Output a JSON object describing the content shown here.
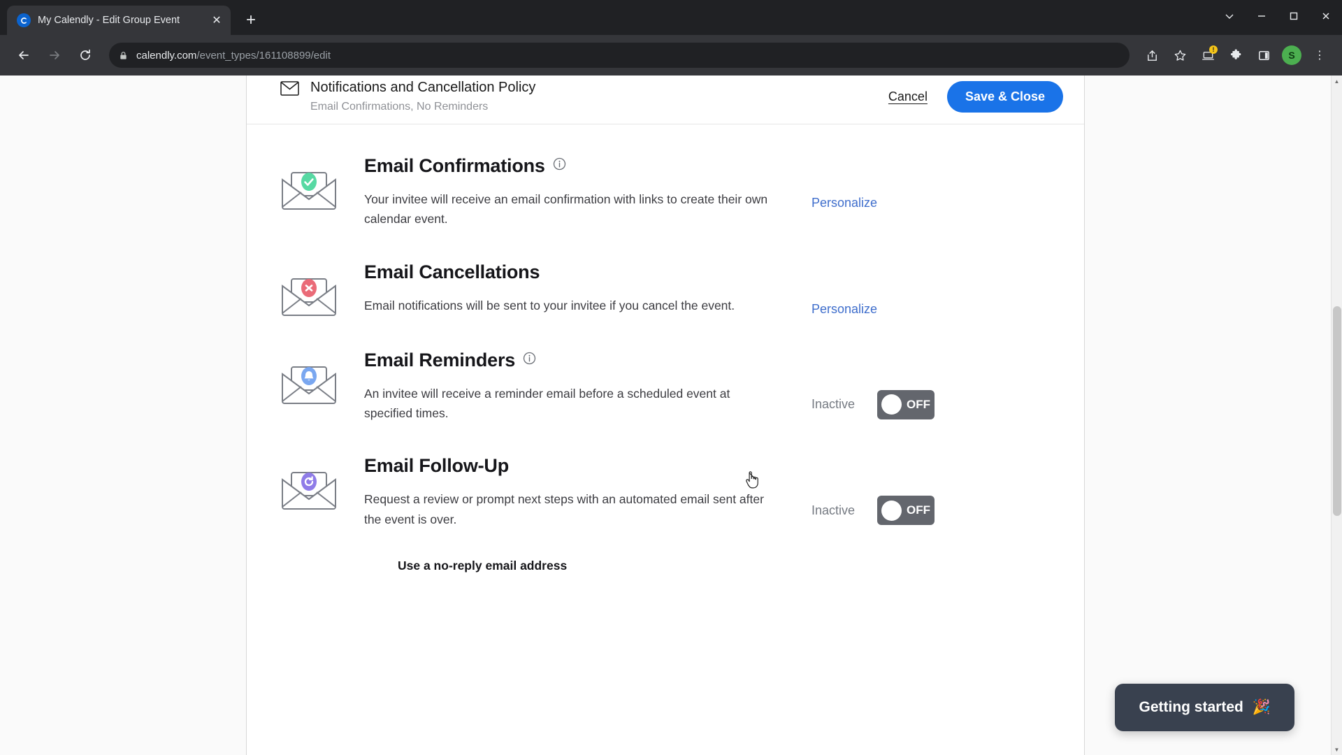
{
  "browser": {
    "tab": {
      "title": "My Calendly - Edit Group Event",
      "favicon_name": "calendly-favicon",
      "close_label": "✕"
    },
    "new_tab_label": "+",
    "window_controls": [
      "minimize-to-tray",
      "minimize",
      "maximize",
      "close"
    ],
    "nav": {
      "back_label": "←",
      "forward_label": "→",
      "reload_label": "↻"
    },
    "omnibox": {
      "domain": "calendly.com",
      "path": "/event_types/161108899/edit",
      "lock_icon": "lock-icon"
    },
    "toolbar_icons": [
      "share-icon",
      "bookmark-star-icon",
      "update-laptop-icon",
      "extensions-puzzle-icon",
      "side-panel-icon"
    ],
    "update_badge": "!",
    "profile_initial": "S",
    "menu_label": "⋮"
  },
  "header": {
    "icon": "mail-outline-icon",
    "title": "Notifications and Cancellation Policy",
    "subtitle": "Email Confirmations, No Reminders",
    "cancel_label": "Cancel",
    "save_label": "Save & Close"
  },
  "accent_colors": {
    "primary_button": "#1a73e8",
    "link": "#3f6ecc",
    "confirm_badge": "#57d9a3",
    "cancel_badge": "#ea6b78",
    "reminder_badge": "#7aa7f0",
    "followup_badge": "#8f7ce8",
    "toggle_off": "#63666d",
    "getting_started_bg": "#39414f"
  },
  "sections": [
    {
      "id": "email-confirmations",
      "badge_icon": "check-circle-icon",
      "badge_color": "#57d9a3",
      "title": "Email Confirmations",
      "has_info": true,
      "description": "Your invitee will receive an email confirmation with links to create their own calendar event.",
      "action_type": "link",
      "action_label": "Personalize"
    },
    {
      "id": "email-cancellations",
      "badge_icon": "x-circle-icon",
      "badge_color": "#ea6b78",
      "title": "Email Cancellations",
      "has_info": false,
      "description": "Email notifications will be sent to your invitee if you cancel the event.",
      "action_type": "link",
      "action_label": "Personalize"
    },
    {
      "id": "email-reminders",
      "badge_icon": "bell-circle-icon",
      "badge_color": "#7aa7f0",
      "title": "Email Reminders",
      "has_info": true,
      "description": "An invitee will receive a reminder email before a scheduled event at specified times.",
      "action_type": "toggle",
      "status_label": "Inactive",
      "toggle_label": "OFF",
      "toggle_state": "off"
    },
    {
      "id": "email-follow-up",
      "badge_icon": "refresh-circle-icon",
      "badge_color": "#8f7ce8",
      "title": "Email Follow-Up",
      "has_info": false,
      "description": "Request a review or prompt next steps with an automated email sent after the event is over.",
      "action_type": "toggle",
      "status_label": "Inactive",
      "toggle_label": "OFF",
      "toggle_state": "off"
    }
  ],
  "footer": {
    "no_reply_label": "Use a no-reply email address"
  },
  "widget": {
    "label": "Getting started",
    "emoji": "🎉"
  }
}
